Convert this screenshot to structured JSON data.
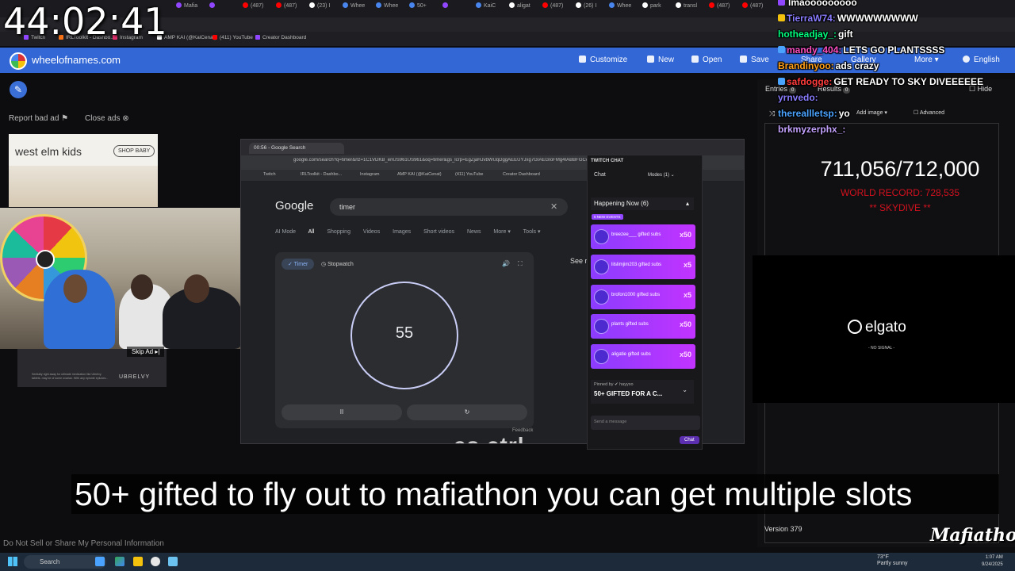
{
  "stream_timer": "44:02:41",
  "browser": {
    "tabs": [
      {
        "label": "Mafia",
        "color": "#9146ff"
      },
      {
        "label": "",
        "color": "#9146ff"
      },
      {
        "label": "(487)",
        "color": "#ff0000"
      },
      {
        "label": "(487)",
        "color": "#ff0000"
      },
      {
        "label": "(23) I",
        "color": "#ffffff"
      },
      {
        "label": "Whee",
        "color": "#4885ed"
      },
      {
        "label": "Whee",
        "color": "#4885ed"
      },
      {
        "label": "50+",
        "color": "#4885ed"
      },
      {
        "label": "",
        "color": "#9146ff"
      },
      {
        "label": "KaiC",
        "color": "#4885ed"
      },
      {
        "label": "aligat",
        "color": "#ffffff"
      },
      {
        "label": "(487)",
        "color": "#ff0000"
      },
      {
        "label": "(26) I",
        "color": "#ffffff"
      },
      {
        "label": "Whee",
        "color": "#4885ed"
      },
      {
        "label": "park",
        "color": "#ffffff"
      },
      {
        "label": "transl",
        "color": "#ffffff"
      },
      {
        "label": "(487)",
        "color": "#ff0000"
      },
      {
        "label": "(487)",
        "color": "#ff0000"
      }
    ],
    "bookmarks": [
      {
        "label": "Twitch",
        "color": "#9146ff"
      },
      {
        "label": "IRLToolkit - Dashbo...",
        "color": "#f97316"
      },
      {
        "label": "Instagram",
        "color": "#e1306c"
      },
      {
        "label": "AMP KAI (@KaiCenat)",
        "color": "#ffffff"
      },
      {
        "label": "(411) YouTube",
        "color": "#ff0000"
      },
      {
        "label": "Creator Dashboard",
        "color": "#9146ff"
      }
    ]
  },
  "won": {
    "site": "wheelofnames.com",
    "menu": [
      "Customize",
      "New",
      "Open",
      "Save",
      "Share",
      "Gallery",
      "More",
      "English"
    ],
    "report_ad": "Report bad ad",
    "close_ads": "Close ads",
    "ad_brand": "west elm kids",
    "ad_shop": "SHOP BABY",
    "skip_ad": "Skip Ad ▸|",
    "ad_small_text": "Sentially right away for ultimate medication like Ubrelvy tablets. may be of some ovarian. With any eplunte eplunes...",
    "ad_brand2": "UBRELVY",
    "tabs": [
      {
        "label": "Entries",
        "count": "0"
      },
      {
        "label": "Results",
        "count": "0"
      }
    ],
    "hide": "Hide",
    "add_image": "Add image",
    "advanced": "Advanced",
    "version": "Version 379",
    "do_not_sell": "Do Not Sell or Share My Personal Information"
  },
  "inner_browser": {
    "tab_title": "00:56 - Google Search",
    "url": "google.com/search?q=timer&rlz=1C1VDKB_enUS961US961&oq=timer&gs_lcrp=EgZjaHJvbWUqDggAEEUYJxg7GIAEGIoFMg4IABBFGCcYOxiABBiKBTIGCAEQRRg5",
    "bookmarks": [
      "Twitch",
      "IRLToolkit - Dashbo...",
      "Instagram",
      "AMP KAI (@KaiCenat)",
      "(411) YouTube",
      "Creator Dashboard"
    ],
    "google": "Google",
    "query": "timer",
    "search_tabs": [
      "AI Mode",
      "All",
      "Shopping",
      "Videos",
      "Images",
      "Short videos",
      "News",
      "More ▾",
      "Tools ▾"
    ],
    "timer_tab": "✓ Timer",
    "stopwatch_tab": "Stopwatch",
    "timer_value": "55",
    "pause": "II",
    "reset": "↻",
    "feedback": "Feedback",
    "see_more": "See r",
    "overlay_text": "es ctrl"
  },
  "twitch_chat": {
    "title": "TWITCH CHAT",
    "chat_label": "Chat",
    "modes": "Modes (1) ⌄",
    "happening": "Happening Now (6)",
    "new_events": "5 NEW EVENTS",
    "gifts": [
      {
        "user": "breezee___",
        "text": "gifted subs",
        "count": "x50"
      },
      {
        "user": "lilslimjim203",
        "text": "gifted subs",
        "count": "x5"
      },
      {
        "user": "brofon1000",
        "text": "gifted subs",
        "count": "x5"
      },
      {
        "user": "plants",
        "text": "gifted subs",
        "count": "x50"
      },
      {
        "user": "aligatie",
        "text": "gifted subs",
        "count": "x50"
      }
    ],
    "pinned_by": "Pinned by ✔ hayyxo",
    "pinned_msg": "50+ GIFTED FOR A C...",
    "send_placeholder": "Send a message",
    "chat_button": "Chat"
  },
  "counter": {
    "value": "711,056/712,000",
    "world_record": "WORLD RECORD: 728,535",
    "skydive": "** SKYDIVE **"
  },
  "elgato": {
    "brand": "elgato",
    "status": "- NO SIGNAL -"
  },
  "overlay_chat": [
    {
      "user": "",
      "message": "lmaooooooooo",
      "user_color": "#ff69b4",
      "badge": "#9146ff"
    },
    {
      "user": "TierraW74:",
      "message": "WWWWWWWWW",
      "user_color": "#8a7dff",
      "badge": "#f4c20d"
    },
    {
      "user": "hotheadjay_:",
      "message": "gift",
      "user_color": "#00ff7f",
      "badge": ""
    },
    {
      "user": "mandy_404:",
      "message": "LETS GO PLANTSSSS",
      "user_color": "#ff4fbf",
      "badge": "#4aa3ff"
    },
    {
      "user": "Brandinyoo:",
      "message": "ads crazy",
      "user_color": "#ff9f1a",
      "badge": ""
    },
    {
      "user": "safdogge:",
      "message": "GET READY TO SKY DIVEEEEEE",
      "user_color": "#ff3b3b",
      "badge": "#4aa3ff"
    },
    {
      "user": "yrnvedo:",
      "message": "",
      "user_color": "#8a7dff",
      "badge": ""
    },
    {
      "user": "thereallletsp:",
      "message": "yo",
      "user_color": "#4aa3ff",
      "badge": ""
    },
    {
      "user": "brkmyzerphx_:",
      "message": "",
      "user_color": "#c4a3ff",
      "badge": ""
    }
  ],
  "caption": "50+ gifted to fly out to mafiathon you can get multiple slots",
  "mafiathon_logo": "Mafiathon3",
  "taskbar": {
    "search": "Search",
    "weather_temp": "73°F",
    "weather_desc": "Partly sunny",
    "time": "1:07 AM",
    "date": "9/24/2025"
  }
}
